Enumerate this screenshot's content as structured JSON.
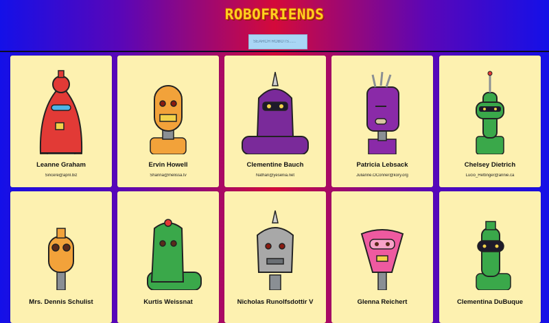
{
  "app": {
    "title": "ROBOFRIENDS"
  },
  "search": {
    "placeholder": "SEARCH ROBOTS......"
  },
  "robots": [
    {
      "name": "Leanne Graham",
      "email": "Sincere@april.biz",
      "color": "#e23a36"
    },
    {
      "name": "Ervin Howell",
      "email": "Shanna@melissa.tv",
      "color": "#f2a23a"
    },
    {
      "name": "Clementine Bauch",
      "email": "Nathan@yesenia.net",
      "color": "#7a2a9a"
    },
    {
      "name": "Patricia Lebsack",
      "email": "Julianne.OConner@kory.org",
      "color": "#8a2aa8"
    },
    {
      "name": "Chelsey Dietrich",
      "email": "Lucio_Hettinger@annie.ca",
      "color": "#3aa84a"
    },
    {
      "name": "Mrs. Dennis Schulist",
      "email": "",
      "color": "#f2a23a"
    },
    {
      "name": "Kurtis Weissnat",
      "email": "",
      "color": "#3aa84a"
    },
    {
      "name": "Nicholas Runolfsdottir V",
      "email": "",
      "color": "#a8a8a8"
    },
    {
      "name": "Glenna Reichert",
      "email": "",
      "color": "#ee5aa0"
    },
    {
      "name": "Clementina DuBuque",
      "email": "",
      "color": "#3aa84a"
    }
  ]
}
